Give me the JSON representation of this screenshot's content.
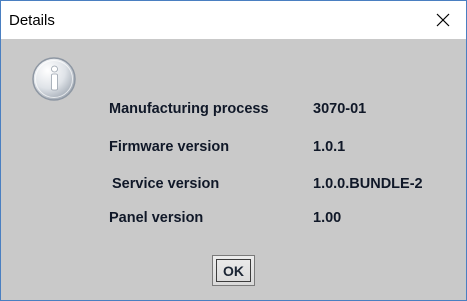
{
  "window": {
    "title": "Details"
  },
  "details": [
    {
      "label": "Manufacturing process",
      "value": "3070-01"
    },
    {
      "label": "Firmware version",
      "value": "1.0.1"
    },
    {
      "label": "Service version",
      "value": "1.0.0.BUNDLE-2"
    },
    {
      "label": "Panel version",
      "value": "1.00"
    }
  ],
  "buttons": {
    "ok_label": "OK"
  },
  "icons": {
    "info": "info-icon",
    "close": "close-icon"
  },
  "colors": {
    "dialog_background": "#c9c9c9",
    "text": "#101828",
    "window_border": "#4a7fc1"
  }
}
